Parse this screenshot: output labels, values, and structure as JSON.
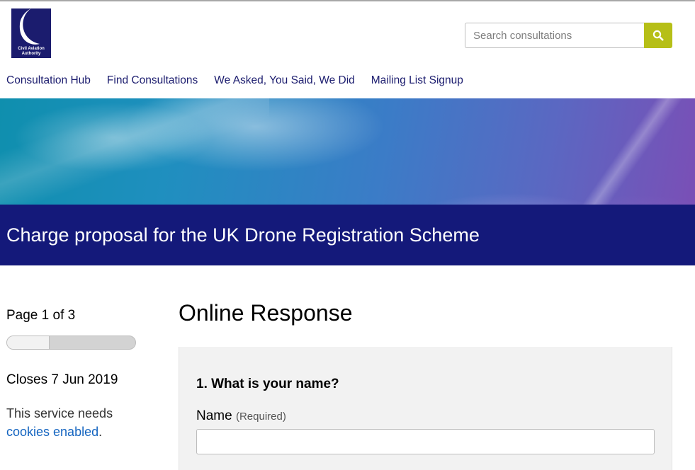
{
  "header": {
    "logo_text": "Civil Aviation\nAuthority",
    "logo_icon": "caa-crescent-logo",
    "search": {
      "placeholder": "Search consultations",
      "value": "",
      "button_icon": "search-icon"
    }
  },
  "nav": {
    "items": [
      {
        "label": "Consultation Hub"
      },
      {
        "label": "Find Consultations"
      },
      {
        "label": "We Asked, You Said, We Did"
      },
      {
        "label": "Mailing List Signup"
      }
    ]
  },
  "consultation": {
    "title": "Charge proposal for the UK Drone Registration Scheme"
  },
  "sidebar": {
    "page_count": "Page 1 of 3",
    "progress_fraction": 0.333,
    "closes": "Closes 7 Jun 2019",
    "cookies_text_before": "This service needs ",
    "cookies_link": "cookies enabled",
    "cookies_text_after": "."
  },
  "main": {
    "heading": "Online Response",
    "question": "1. What is your name?",
    "field_label": "Name",
    "field_required": "(Required)",
    "field_value": ""
  },
  "colors": {
    "brand_navy": "#14197a",
    "search_button": "#b6bf17",
    "link_blue": "#1565c0"
  }
}
